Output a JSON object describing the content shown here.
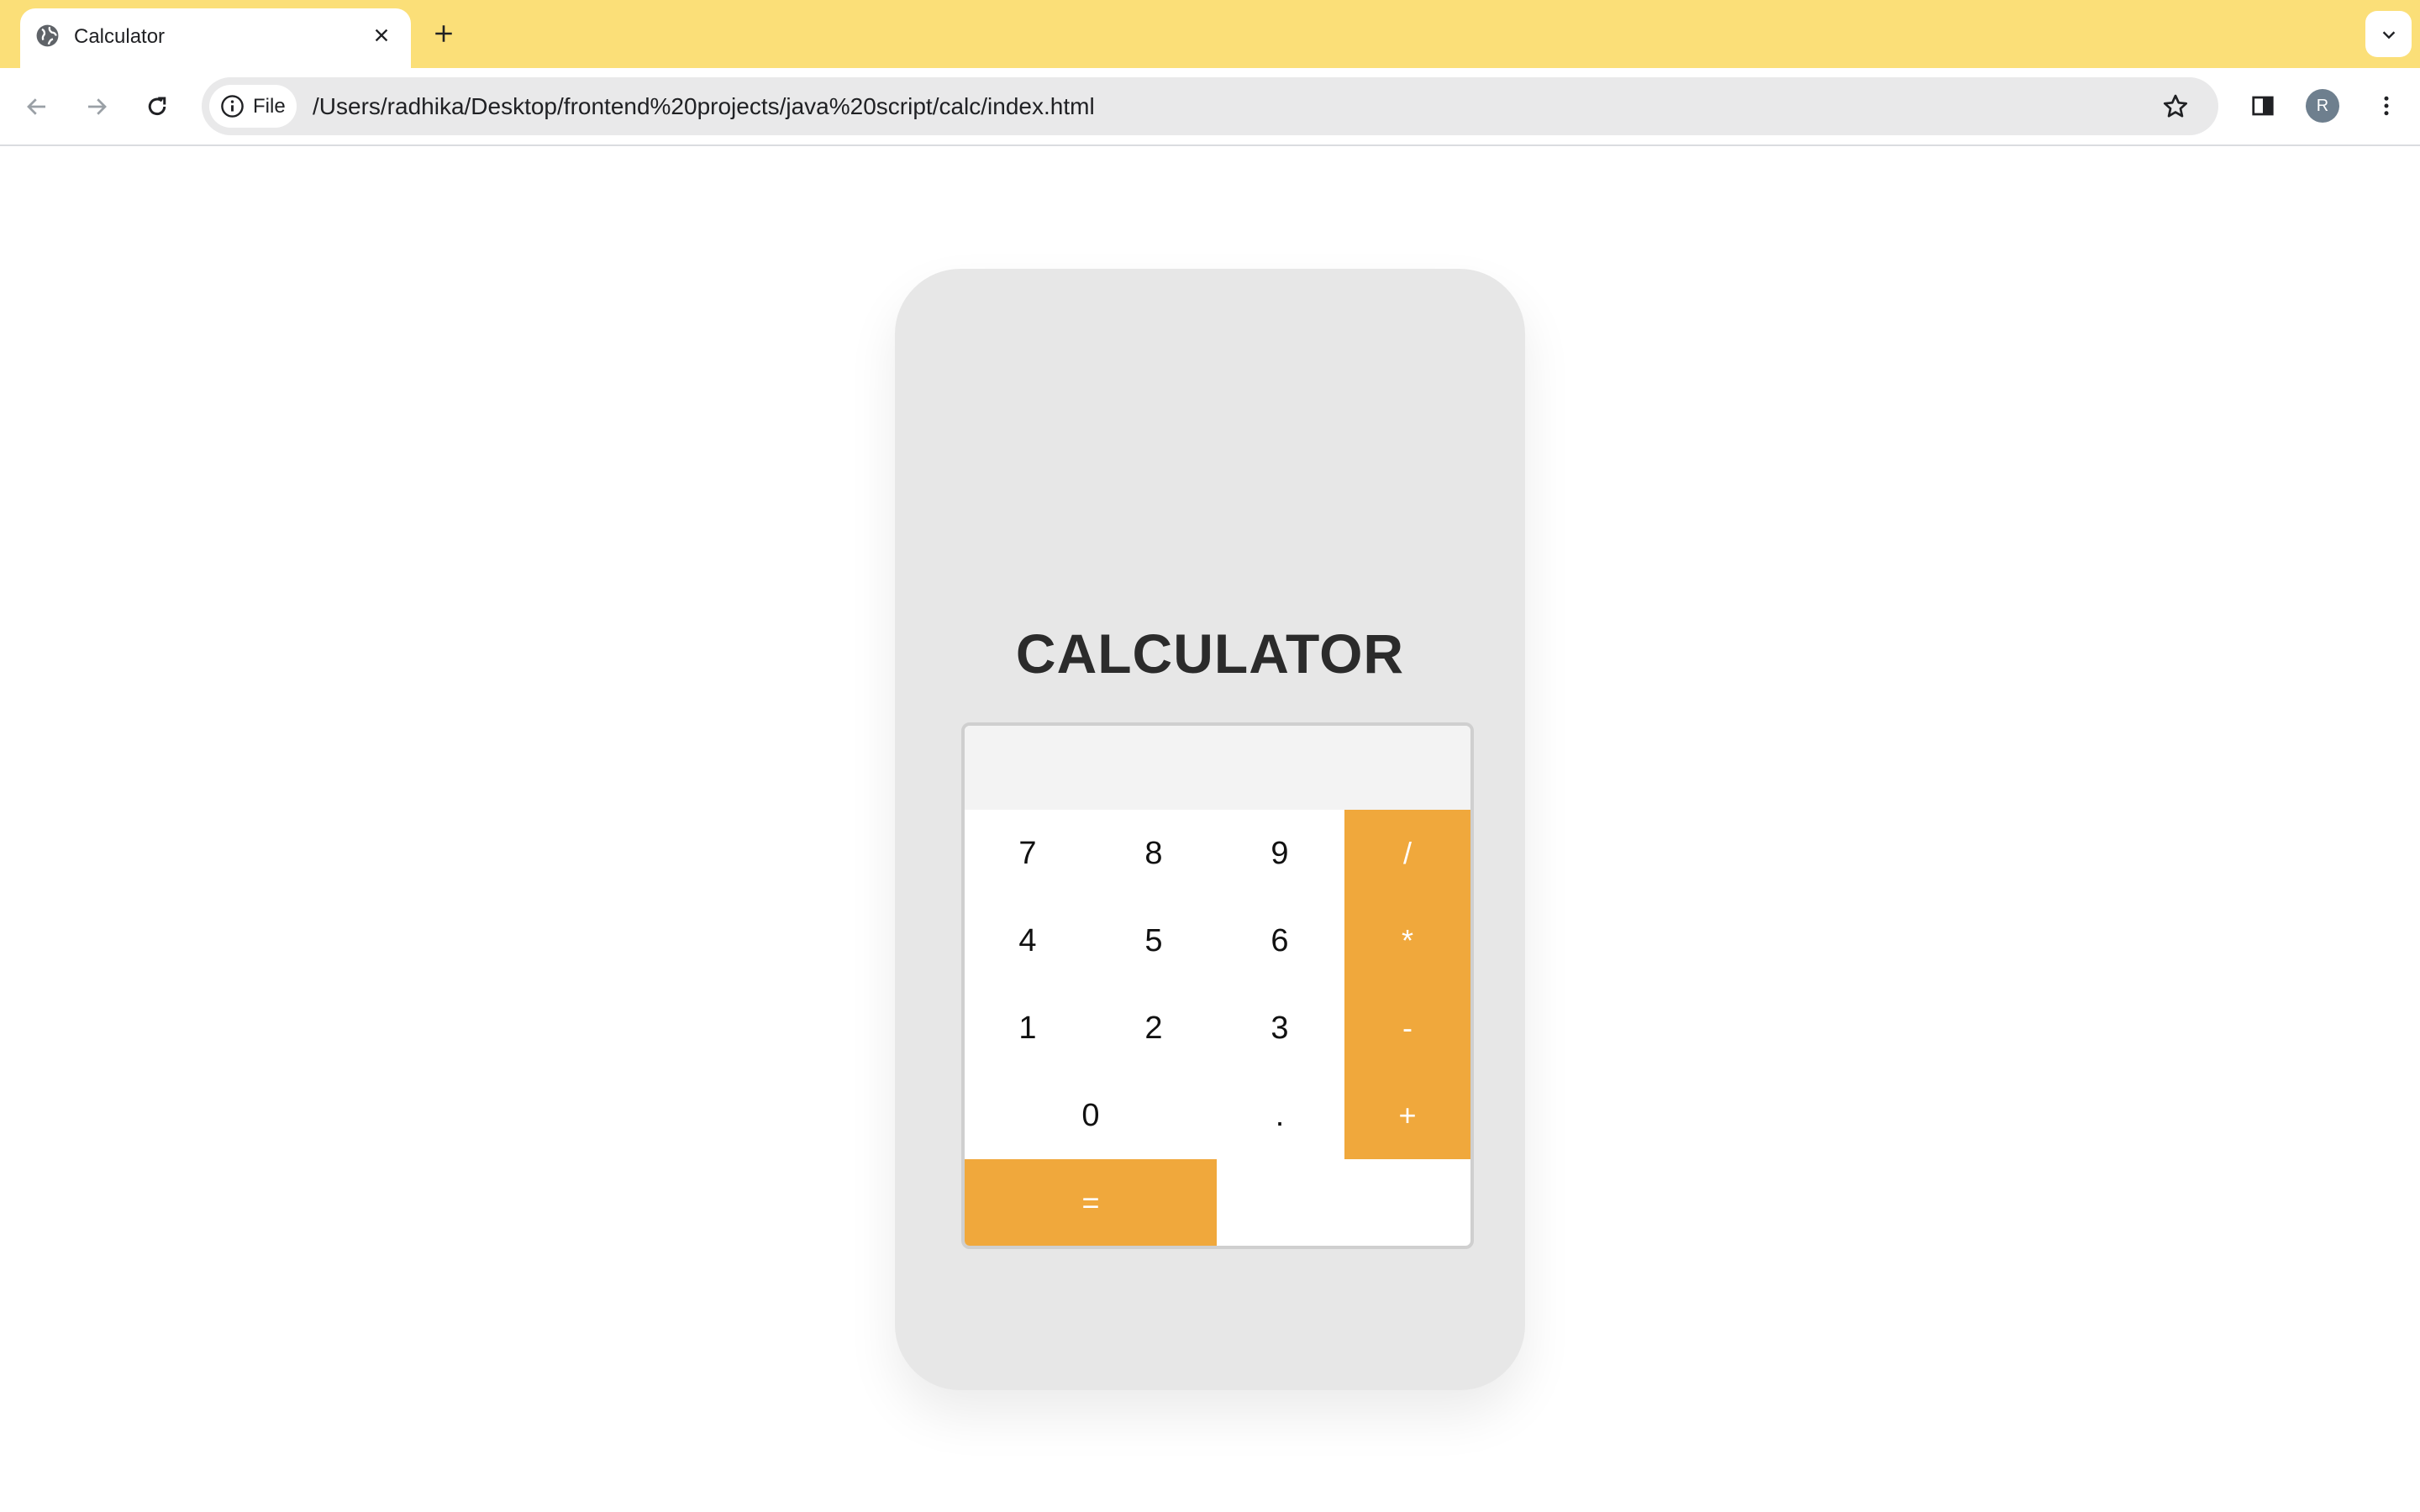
{
  "browser": {
    "tab_title": "Calculator",
    "site_chip_label": "File",
    "url": "/Users/radhika/Desktop/frontend%20projects/java%20script/calc/index.html",
    "profile_initial": "R",
    "tabbar_color": "#fbdf78"
  },
  "page": {
    "heading": "CALCULATOR",
    "display_value": "",
    "accent_color": "#f0a83c",
    "keys": {
      "k7": "7",
      "k8": "8",
      "k9": "9",
      "divide": "/",
      "k4": "4",
      "k5": "5",
      "k6": "6",
      "multiply": "*",
      "k1": "1",
      "k2": "2",
      "k3": "3",
      "subtract": "-",
      "k0": "0",
      "decimal": ".",
      "add": "+",
      "equals": "="
    }
  }
}
